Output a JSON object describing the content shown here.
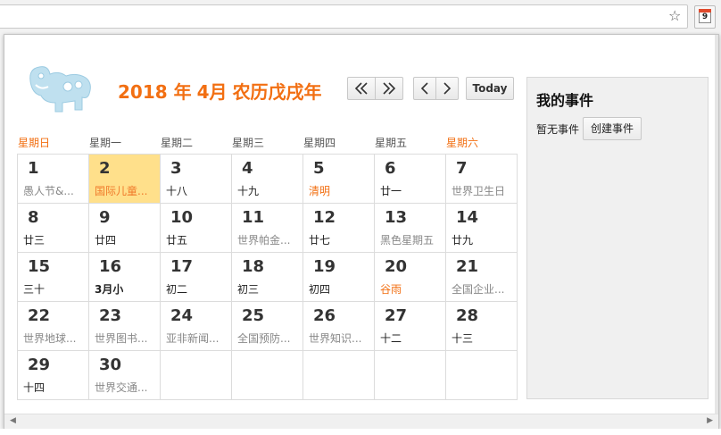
{
  "browser": {
    "extension_badge": "9"
  },
  "header": {
    "year": "2018 年",
    "month": "4月",
    "lunar": "农历戊戌年",
    "today_label": "Today"
  },
  "weekdays": [
    "星期日",
    "星期一",
    "星期二",
    "星期三",
    "星期四",
    "星期五",
    "星期六"
  ],
  "weeks": [
    [
      {
        "day": "1",
        "sub": "愚人节&...",
        "style": "grey"
      },
      {
        "day": "2",
        "sub": "国际儿童...",
        "style": "grey",
        "selected": true
      },
      {
        "day": "3",
        "sub": "十八",
        "style": "dark"
      },
      {
        "day": "4",
        "sub": "十九",
        "style": "dark"
      },
      {
        "day": "5",
        "sub": "清明",
        "style": "orange"
      },
      {
        "day": "6",
        "sub": "廿一",
        "style": "dark"
      },
      {
        "day": "7",
        "sub": "世界卫生日",
        "style": "grey"
      }
    ],
    [
      {
        "day": "8",
        "sub": "廿三",
        "style": "dark"
      },
      {
        "day": "9",
        "sub": "廿四",
        "style": "dark"
      },
      {
        "day": "10",
        "sub": "廿五",
        "style": "dark"
      },
      {
        "day": "11",
        "sub": "世界帕金...",
        "style": "grey"
      },
      {
        "day": "12",
        "sub": "廿七",
        "style": "dark"
      },
      {
        "day": "13",
        "sub": "黑色星期五",
        "style": "grey"
      },
      {
        "day": "14",
        "sub": "廿九",
        "style": "dark"
      }
    ],
    [
      {
        "day": "15",
        "sub": "三十",
        "style": "dark"
      },
      {
        "day": "16",
        "sub": "3月小",
        "style": "bold"
      },
      {
        "day": "17",
        "sub": "初二",
        "style": "dark"
      },
      {
        "day": "18",
        "sub": "初三",
        "style": "dark"
      },
      {
        "day": "19",
        "sub": "初四",
        "style": "dark"
      },
      {
        "day": "20",
        "sub": "谷雨",
        "style": "orange"
      },
      {
        "day": "21",
        "sub": "全国企业...",
        "style": "grey"
      }
    ],
    [
      {
        "day": "22",
        "sub": "世界地球...",
        "style": "grey"
      },
      {
        "day": "23",
        "sub": "世界图书...",
        "style": "grey"
      },
      {
        "day": "24",
        "sub": "亚非新闻...",
        "style": "grey"
      },
      {
        "day": "25",
        "sub": "全国预防...",
        "style": "grey"
      },
      {
        "day": "26",
        "sub": "世界知识...",
        "style": "grey"
      },
      {
        "day": "27",
        "sub": "十二",
        "style": "dark"
      },
      {
        "day": "28",
        "sub": "十三",
        "style": "dark"
      }
    ],
    [
      {
        "day": "29",
        "sub": "十四",
        "style": "dark"
      },
      {
        "day": "30",
        "sub": "世界交通...",
        "style": "grey"
      },
      {
        "day": "",
        "sub": "",
        "style": "grey"
      },
      {
        "day": "",
        "sub": "",
        "style": "grey"
      },
      {
        "day": "",
        "sub": "",
        "style": "grey"
      },
      {
        "day": "",
        "sub": "",
        "style": "grey"
      },
      {
        "day": "",
        "sub": "",
        "style": "grey"
      }
    ]
  ],
  "sidebar": {
    "title": "我的事件",
    "empty_text": "暂无事件",
    "create_label": "创建事件"
  },
  "colors": {
    "accent": "#f26f12",
    "selected": "#ffe08b"
  }
}
